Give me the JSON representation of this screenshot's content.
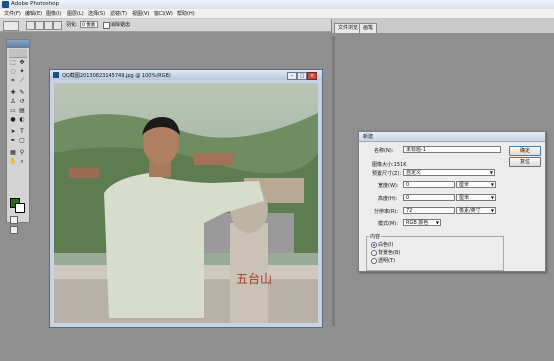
{
  "app": {
    "title": "Adobe Photoshop"
  },
  "menu": [
    "文件(F)",
    "编辑(E)",
    "图像(I)",
    "图层(L)",
    "选择(S)",
    "滤镜(T)",
    "视图(V)",
    "窗口(W)",
    "帮助(H)"
  ],
  "options": {
    "feather_label": "羽化:",
    "feather_value": "0 像素",
    "antialias_label": "消除锯齿"
  },
  "palette_tabs": [
    "文件浏览",
    "画笔"
  ],
  "document": {
    "title": "QQ截图20130823145749.jpg @ 100%(RGB)"
  },
  "dialog": {
    "title": "新建",
    "name_label": "名称(N):",
    "name_value": "未标题-1",
    "image_size_label": "图像大小:151K",
    "preset_label": "预置尺寸(Z):",
    "preset_value": "自定义",
    "width_label": "宽度(W):",
    "width_value": "0",
    "width_unit": "厘米",
    "height_label": "高度(H):",
    "height_value": "0",
    "height_unit": "厘米",
    "resolution_label": "分辨率(R):",
    "resolution_value": "72",
    "resolution_unit": "像素/英寸",
    "mode_label": "模式(M):",
    "mode_value": "RGB 颜色",
    "contents_title": "内容",
    "contents_options": [
      "白色(I)",
      "背景色(B)",
      "透明(T)"
    ],
    "ok_label": "确定",
    "reset_label": "复位"
  },
  "colors": {
    "foreground": "#2a6b1e",
    "background": "#ffffff",
    "workspace": "#8f8f8f"
  },
  "icons": {
    "toolbox": [
      "marquee-icon",
      "move-icon",
      "lasso-icon",
      "magic-wand-icon",
      "crop-icon",
      "slice-icon",
      "healing-brush-icon",
      "brush-icon",
      "clone-stamp-icon",
      "history-brush-icon",
      "eraser-icon",
      "gradient-icon",
      "blur-icon",
      "dodge-icon",
      "path-selection-icon",
      "type-icon",
      "pen-icon",
      "shape-icon",
      "notes-icon",
      "eyedropper-icon",
      "hand-icon",
      "zoom-icon"
    ]
  }
}
